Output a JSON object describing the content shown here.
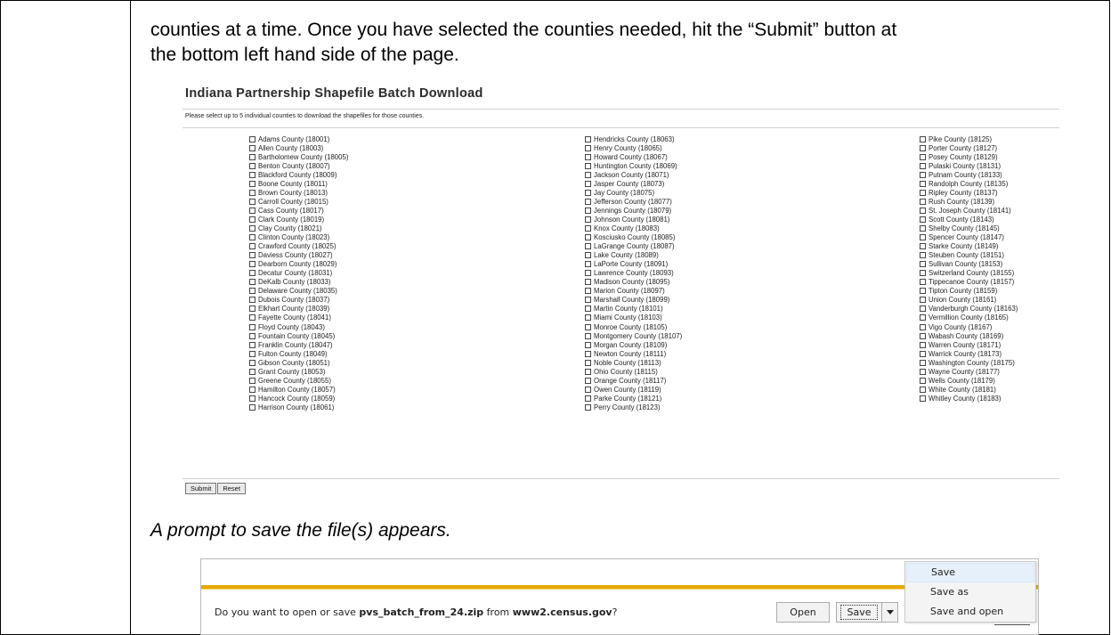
{
  "doc": {
    "intro_line1": "counties at a time. Once you have selected the counties needed, hit the “Submit” button at",
    "intro_line2": "the bottom left hand side of the page.",
    "prompt_caption": "A prompt to save the file(s) appears."
  },
  "batch": {
    "title": "Indiana Partnership Shapefile Batch Download",
    "instructions": "Please select up to 5 individual counties to download the shapefiles for those counties.",
    "submit_label": "Submit",
    "reset_label": "Reset",
    "columns": [
      [
        "Adams County (18001)",
        "Allen County (18003)",
        "Bartholomew County (18005)",
        "Benton County (18007)",
        "Blackford County (18009)",
        "Boone County (18011)",
        "Brown County (18013)",
        "Carroll County (18015)",
        "Cass County (18017)",
        "Clark County (18019)",
        "Clay County (18021)",
        "Clinton County (18023)",
        "Crawford County (18025)",
        "Daviess County (18027)",
        "Dearborn County (18029)",
        "Decatur County (18031)",
        "DeKalb County (18033)",
        "Delaware County (18035)",
        "Dubois County (18037)",
        "Elkhart County (18039)",
        "Fayette County (18041)",
        "Floyd County (18043)",
        "Fountain County (18045)",
        "Franklin County (18047)",
        "Fulton County (18049)",
        "Gibson County (18051)",
        "Grant County (18053)",
        "Greene County (18055)",
        "Hamilton County (18057)",
        "Hancock County (18059)",
        "Harrison County (18061)"
      ],
      [
        "Hendricks County (18063)",
        "Henry County (18065)",
        "Howard County (18067)",
        "Huntington County (18069)",
        "Jackson County (18071)",
        "Jasper County (18073)",
        "Jay County (18075)",
        "Jefferson County (18077)",
        "Jennings County (18079)",
        "Johnson County (18081)",
        "Knox County (18083)",
        "Kosciusko County (18085)",
        "LaGrange County (18087)",
        "Lake County (18089)",
        "LaPorte County (18091)",
        "Lawrence County (18093)",
        "Madison County (18095)",
        "Marion County (18097)",
        "Marshall County (18099)",
        "Martin County (18101)",
        "Miami County (18103)",
        "Monroe County (18105)",
        "Montgomery County (18107)",
        "Morgan County (18109)",
        "Newton County (18111)",
        "Noble County (18113)",
        "Ohio County (18115)",
        "Orange County (18117)",
        "Owen County (18119)",
        "Parke County (18121)",
        "Perry County (18123)"
      ],
      [
        "Pike County (18125)",
        "Porter County (18127)",
        "Posey County (18129)",
        "Pulaski County (18131)",
        "Putnam County (18133)",
        "Randolph County (18135)",
        "Ripley County (18137)",
        "Rush County (18139)",
        "St. Joseph County (18141)",
        "Scott County (18143)",
        "Shelby County (18145)",
        "Spencer County (18147)",
        "Starke County (18149)",
        "Steuben County (18151)",
        "Sullivan County (18153)",
        "Switzerland County (18155)",
        "Tippecanoe County (18157)",
        "Tipton County (18159)",
        "Union County (18161)",
        "Vanderburgh County (18163)",
        "Vermillion County (18165)",
        "Vigo County (18167)",
        "Wabash County (18169)",
        "Warren County (18171)",
        "Warrick County (18173)",
        "Washington County (18175)",
        "Wayne County (18177)",
        "Wells County (18179)",
        "White County (18181)",
        "Whitley County (18183)"
      ]
    ]
  },
  "download_bar": {
    "message_prefix": "Do you want to open or save ",
    "file_name": "pvs_batch_from_24.zip",
    "message_mid": " from ",
    "site": "www2.census.gov",
    "message_suffix": "?",
    "open_label": "Open",
    "save_label": "Save",
    "accent_color": "#e8a800"
  },
  "save_menu": {
    "items": [
      "Save",
      "Save as",
      "Save and open"
    ]
  }
}
